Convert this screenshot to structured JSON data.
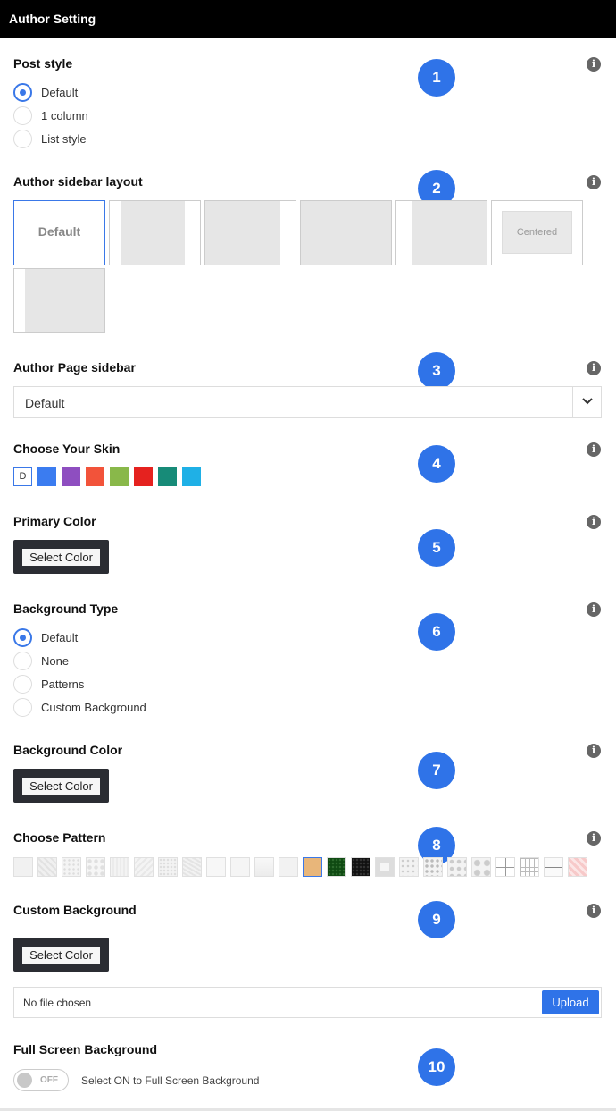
{
  "header": {
    "title": "Author Setting"
  },
  "info_glyph": "i",
  "post_style": {
    "title": "Post style",
    "badge": "1",
    "options": [
      "Default",
      "1 column",
      "List style"
    ],
    "selected": 0
  },
  "sidebar_layout": {
    "title": "Author sidebar layout",
    "badge": "2",
    "default_label": "Default",
    "centered_label": "Centered"
  },
  "page_sidebar": {
    "title": "Author Page sidebar",
    "badge": "3",
    "value": "Default"
  },
  "skin": {
    "title": "Choose Your Skin",
    "badge": "4",
    "default_letter": "D",
    "colors": [
      "#3b7cf0",
      "#8e4ec0",
      "#f2533a",
      "#89b84a",
      "#e5221f",
      "#178b78",
      "#1fb0e6"
    ]
  },
  "primary_color": {
    "title": "Primary Color",
    "badge": "5",
    "button": "Select Color"
  },
  "background_type": {
    "title": "Background Type",
    "badge": "6",
    "options": [
      "Default",
      "None",
      "Patterns",
      "Custom Background"
    ],
    "selected": 0
  },
  "background_color": {
    "title": "Background Color",
    "badge": "7",
    "button": "Select Color"
  },
  "pattern": {
    "title": "Choose Pattern",
    "badge": "8"
  },
  "custom_background": {
    "title": "Custom Background",
    "badge": "9",
    "button": "Select Color",
    "file_text": "No file chosen",
    "upload_label": "Upload"
  },
  "full_screen": {
    "title": "Full Screen Background",
    "badge": "10",
    "toggle_label": "OFF",
    "description": "Select ON to Full Screen Background"
  }
}
